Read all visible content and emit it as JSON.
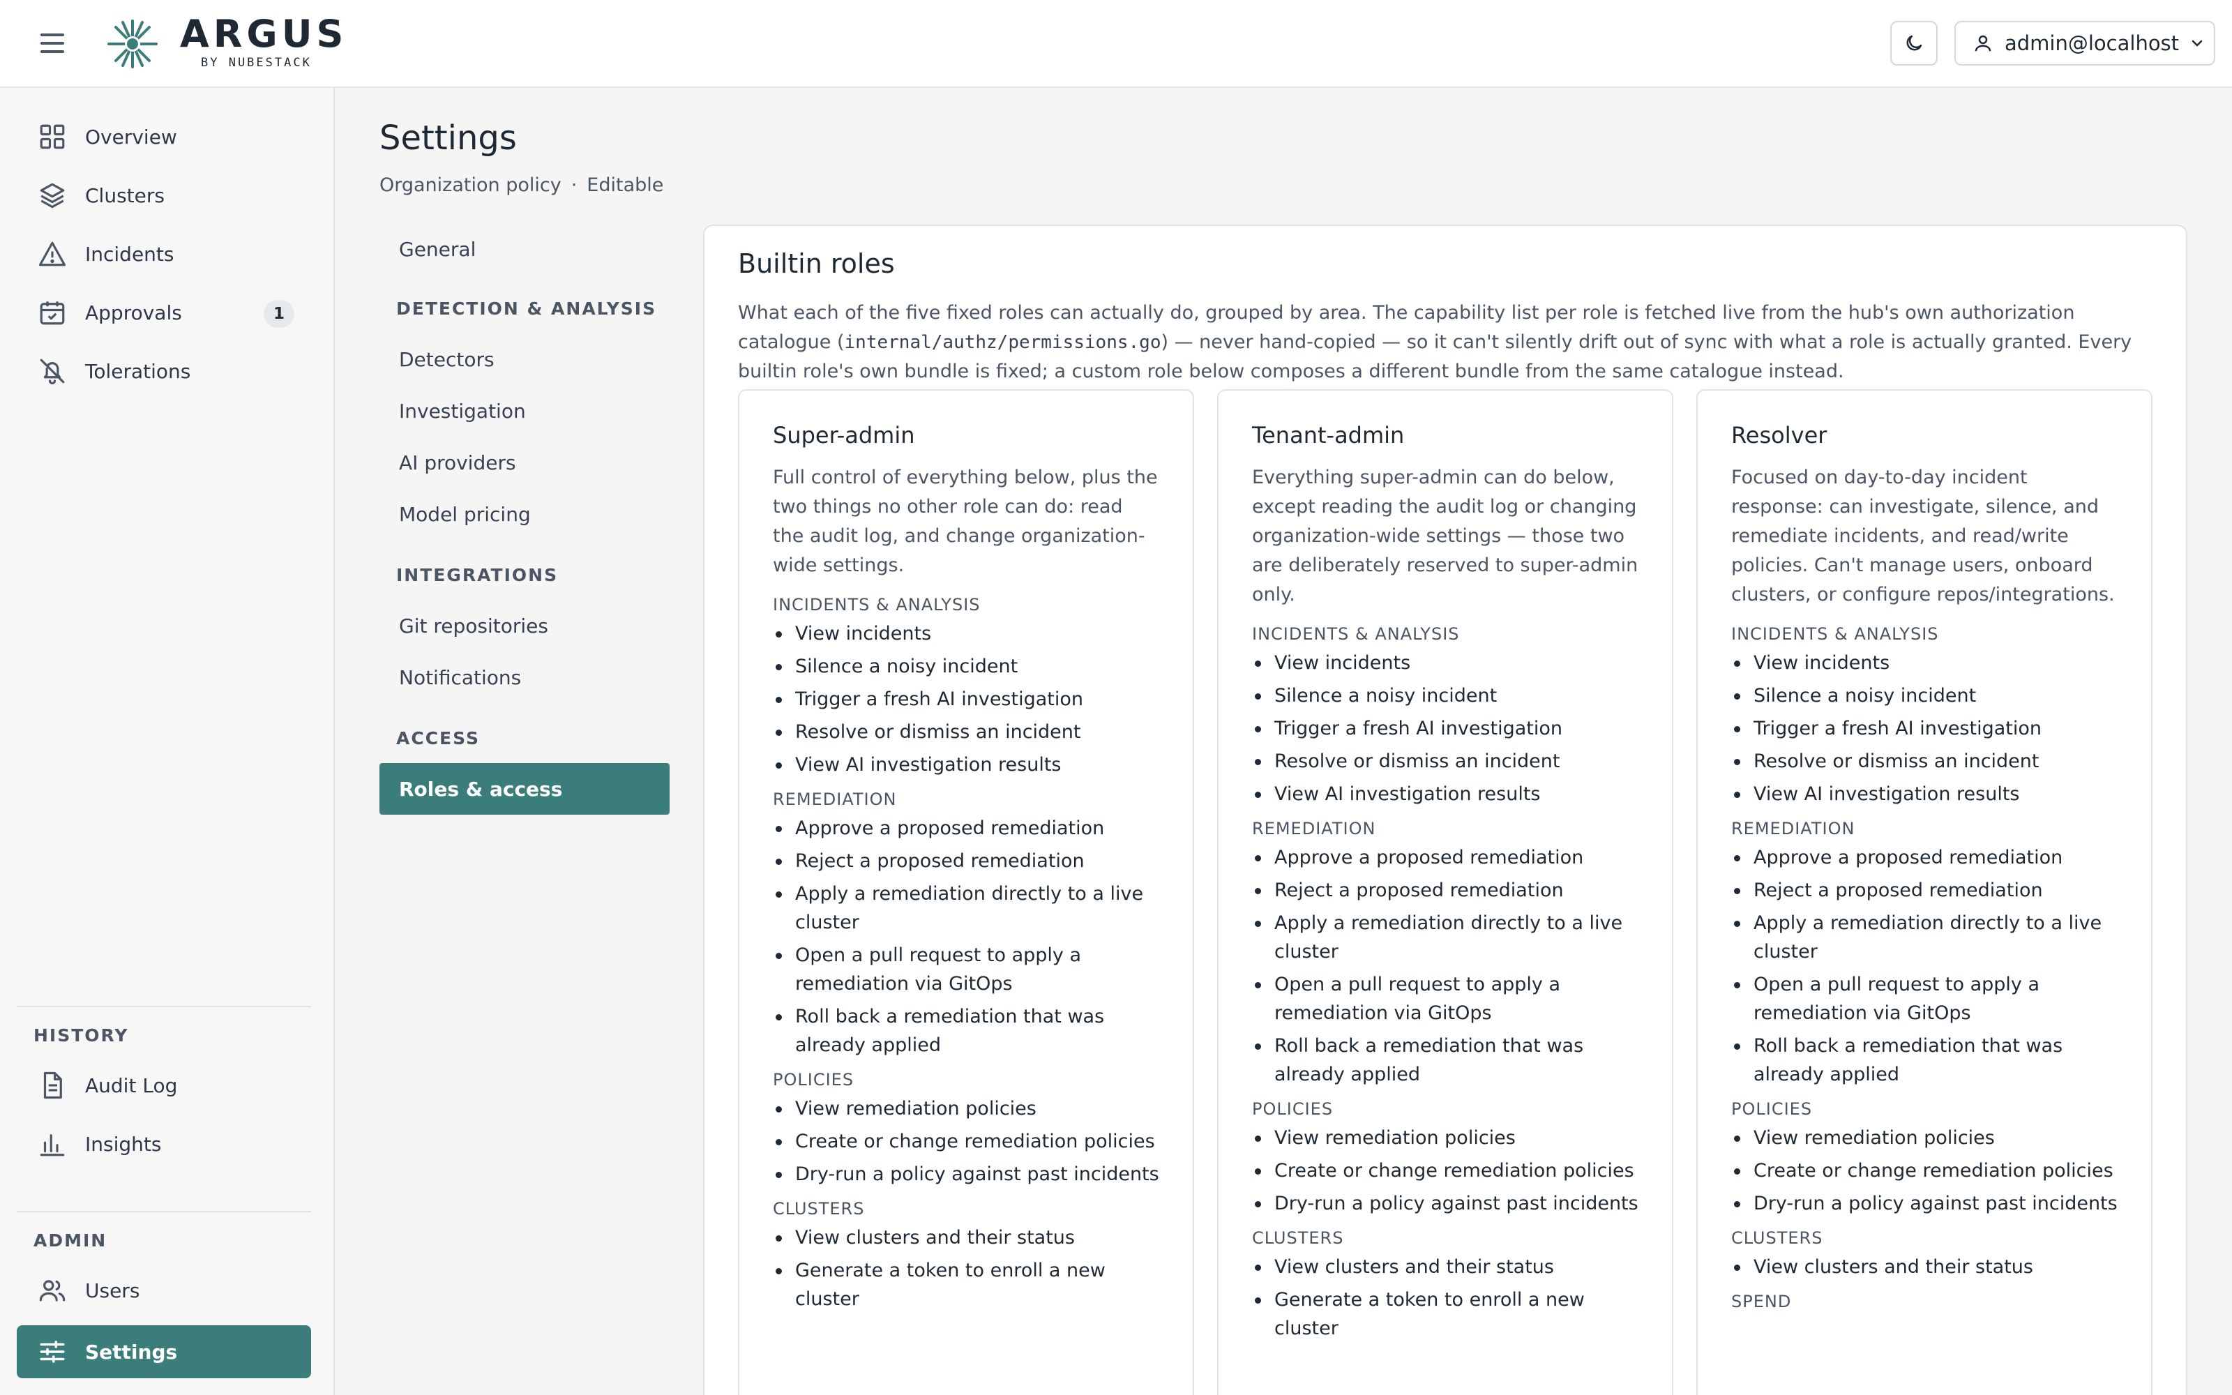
{
  "app": {
    "name": "ARGUS",
    "subtitle": "BY NUBESTACK",
    "user": "admin@localhost"
  },
  "sidebar": {
    "items": [
      {
        "label": "Overview",
        "icon": "grid-icon"
      },
      {
        "label": "Clusters",
        "icon": "layers-icon"
      },
      {
        "label": "Incidents",
        "icon": "warning-triangle-icon"
      },
      {
        "label": "Approvals",
        "icon": "calendar-check-icon",
        "badge": "1"
      },
      {
        "label": "Tolerations",
        "icon": "bell-off-icon"
      }
    ],
    "history_heading": "HISTORY",
    "history_items": [
      {
        "label": "Audit Log",
        "icon": "document-icon"
      },
      {
        "label": "Insights",
        "icon": "bar-chart-icon"
      }
    ],
    "admin_heading": "ADMIN",
    "admin_items": [
      {
        "label": "Users",
        "icon": "users-icon"
      },
      {
        "label": "Settings",
        "icon": "sliders-icon"
      }
    ]
  },
  "page": {
    "title": "Settings",
    "subtitle_left": "Organization policy",
    "subtitle_sep": "·",
    "subtitle_right": "Editable"
  },
  "settings_nav": {
    "general": "General",
    "detection_heading": "DETECTION & ANALYSIS",
    "detectors": "Detectors",
    "investigation": "Investigation",
    "ai_providers": "AI providers",
    "model_pricing": "Model pricing",
    "integrations_heading": "INTEGRATIONS",
    "git_repositories": "Git repositories",
    "notifications": "Notifications",
    "access_heading": "ACCESS",
    "roles_access": "Roles & access"
  },
  "panel": {
    "title": "Builtin roles",
    "desc_1": "What each of the five fixed roles can actually do, grouped by area. The capability list per role is fetched live from the hub's own authorization catalogue (",
    "desc_code": "internal/authz/permissions.go",
    "desc_2": ") — never hand-copied — so it can't silently drift out of sync with what a role is actually granted. Every builtin role's own bundle is fixed; a custom role below composes a different bundle from the same catalogue instead."
  },
  "roles": [
    {
      "name": "Super-admin",
      "desc": "Full control of everything below, plus the two things no other role can do: read the audit log, and change organization-wide settings.",
      "groups": [
        {
          "title": "INCIDENTS & ANALYSIS",
          "items": [
            "View incidents",
            "Silence a noisy incident",
            "Trigger a fresh AI investigation",
            "Resolve or dismiss an incident",
            "View AI investigation results"
          ]
        },
        {
          "title": "REMEDIATION",
          "items": [
            "Approve a proposed remediation",
            "Reject a proposed remediation",
            "Apply a remediation directly to a live cluster",
            "Open a pull request to apply a remediation via GitOps",
            "Roll back a remediation that was already applied"
          ]
        },
        {
          "title": "POLICIES",
          "items": [
            "View remediation policies",
            "Create or change remediation policies",
            "Dry-run a policy against past incidents"
          ]
        },
        {
          "title": "CLUSTERS",
          "items": [
            "View clusters and their status",
            "Generate a token to enroll a new cluster"
          ]
        }
      ]
    },
    {
      "name": "Tenant-admin",
      "desc": "Everything super-admin can do below, except reading the audit log or changing organization-wide settings — those two are deliberately reserved to super-admin only.",
      "groups": [
        {
          "title": "INCIDENTS & ANALYSIS",
          "items": [
            "View incidents",
            "Silence a noisy incident",
            "Trigger a fresh AI investigation",
            "Resolve or dismiss an incident",
            "View AI investigation results"
          ]
        },
        {
          "title": "REMEDIATION",
          "items": [
            "Approve a proposed remediation",
            "Reject a proposed remediation",
            "Apply a remediation directly to a live cluster",
            "Open a pull request to apply a remediation via GitOps",
            "Roll back a remediation that was already applied"
          ]
        },
        {
          "title": "POLICIES",
          "items": [
            "View remediation policies",
            "Create or change remediation policies",
            "Dry-run a policy against past incidents"
          ]
        },
        {
          "title": "CLUSTERS",
          "items": [
            "View clusters and their status",
            "Generate a token to enroll a new cluster"
          ]
        }
      ]
    },
    {
      "name": "Resolver",
      "desc": "Focused on day-to-day incident response: can investigate, silence, and remediate incidents, and read/write policies. Can't manage users, onboard clusters, or configure repos/integrations.",
      "groups": [
        {
          "title": "INCIDENTS & ANALYSIS",
          "items": [
            "View incidents",
            "Silence a noisy incident",
            "Trigger a fresh AI investigation",
            "Resolve or dismiss an incident",
            "View AI investigation results"
          ]
        },
        {
          "title": "REMEDIATION",
          "items": [
            "Approve a proposed remediation",
            "Reject a proposed remediation",
            "Apply a remediation directly to a live cluster",
            "Open a pull request to apply a remediation via GitOps",
            "Roll back a remediation that was already applied"
          ]
        },
        {
          "title": "POLICIES",
          "items": [
            "View remediation policies",
            "Create or change remediation policies",
            "Dry-run a policy against past incidents"
          ]
        },
        {
          "title": "CLUSTERS",
          "items": [
            "View clusters and their status"
          ]
        },
        {
          "title": "SPEND",
          "items": []
        }
      ]
    }
  ],
  "colors": {
    "accent": "#3b7d7b",
    "text": "#1f2933",
    "muted": "#4b5563",
    "border": "#dfe2e6"
  }
}
